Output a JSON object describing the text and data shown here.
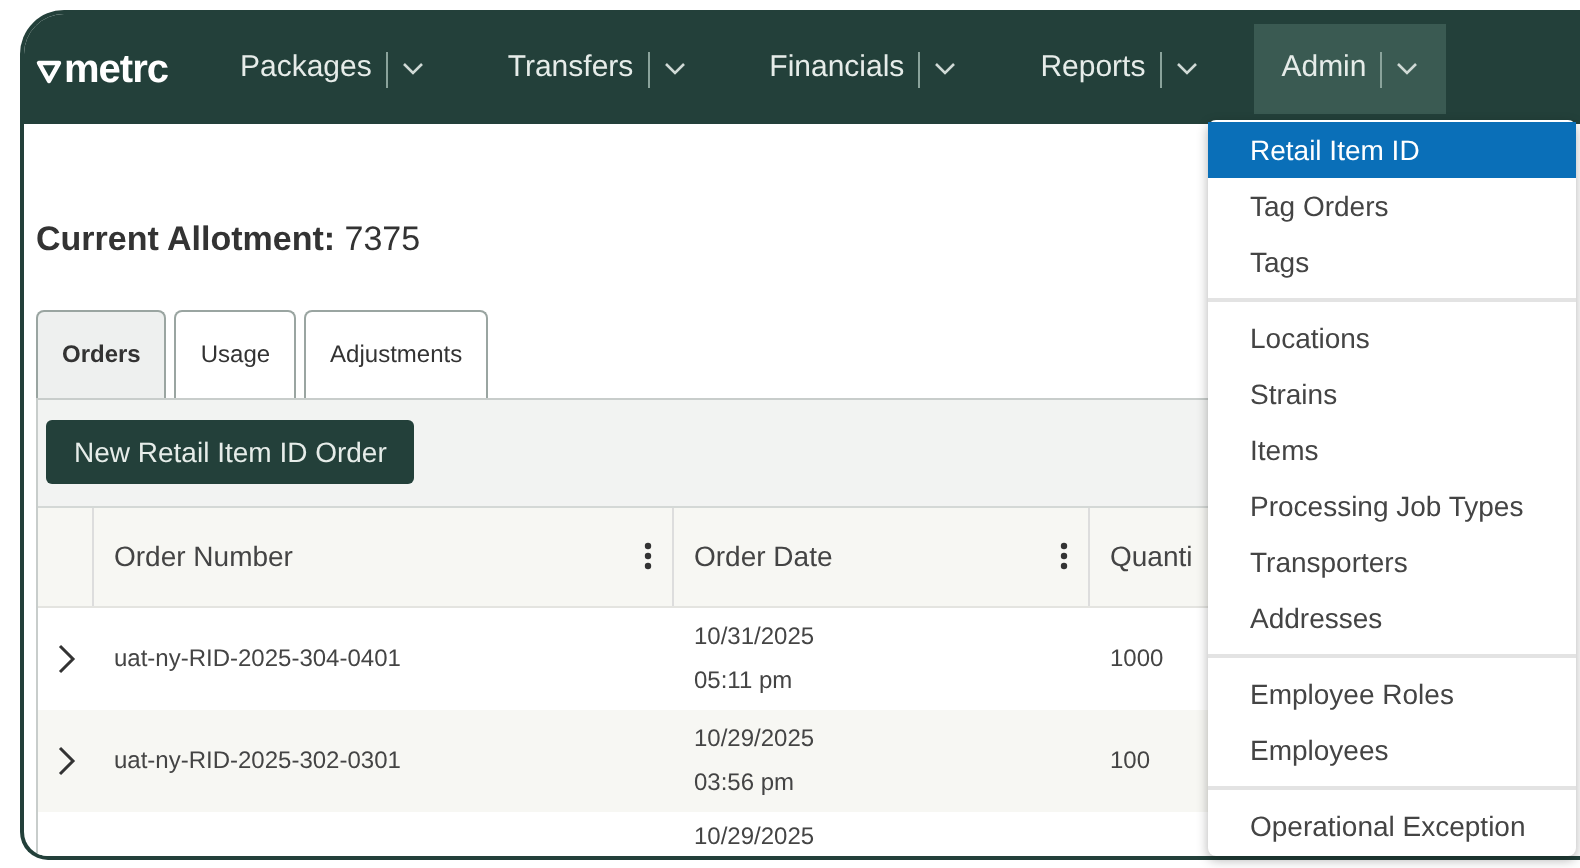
{
  "nav": {
    "logo": "metrc",
    "items": [
      {
        "label": "Packages",
        "selected": false
      },
      {
        "label": "Transfers",
        "selected": false
      },
      {
        "label": "Financials",
        "selected": false
      },
      {
        "label": "Reports",
        "selected": false
      },
      {
        "label": "Admin",
        "selected": true
      }
    ]
  },
  "allotment": {
    "label": "Current Allotment:",
    "value": "7375"
  },
  "tabs": [
    {
      "label": "Orders",
      "selected": true
    },
    {
      "label": "Usage",
      "selected": false
    },
    {
      "label": "Adjustments",
      "selected": false
    }
  ],
  "new_order_button": "New Retail Item ID Order",
  "table": {
    "columns": [
      "Order Number",
      "Order Date",
      "Quanti"
    ],
    "rows": [
      {
        "expanded": false,
        "order_number": "uat-ny-RID-2025-304-0401",
        "date": [
          "10/31/2025",
          "05:11 pm"
        ],
        "quantity": "1000"
      },
      {
        "expanded": false,
        "order_number": "uat-ny-RID-2025-302-0301",
        "date": [
          "10/29/2025",
          "03:56 pm"
        ],
        "quantity": "100"
      },
      {
        "date": [
          "10/29/2025"
        ]
      }
    ]
  },
  "admin_menu": [
    [
      {
        "label": "Retail Item ID",
        "selected": true
      },
      {
        "label": "Tag Orders",
        "selected": false
      },
      {
        "label": "Tags",
        "selected": false
      }
    ],
    [
      {
        "label": "Locations",
        "selected": false
      },
      {
        "label": "Strains",
        "selected": false
      },
      {
        "label": "Items",
        "selected": false
      },
      {
        "label": "Processing Job Types",
        "selected": false
      },
      {
        "label": "Transporters",
        "selected": false
      },
      {
        "label": "Addresses",
        "selected": false
      }
    ],
    [
      {
        "label": "Employee Roles",
        "selected": false
      },
      {
        "label": "Employees",
        "selected": false
      }
    ],
    [
      {
        "label": "Operational Exception",
        "selected": false
      }
    ]
  ]
}
